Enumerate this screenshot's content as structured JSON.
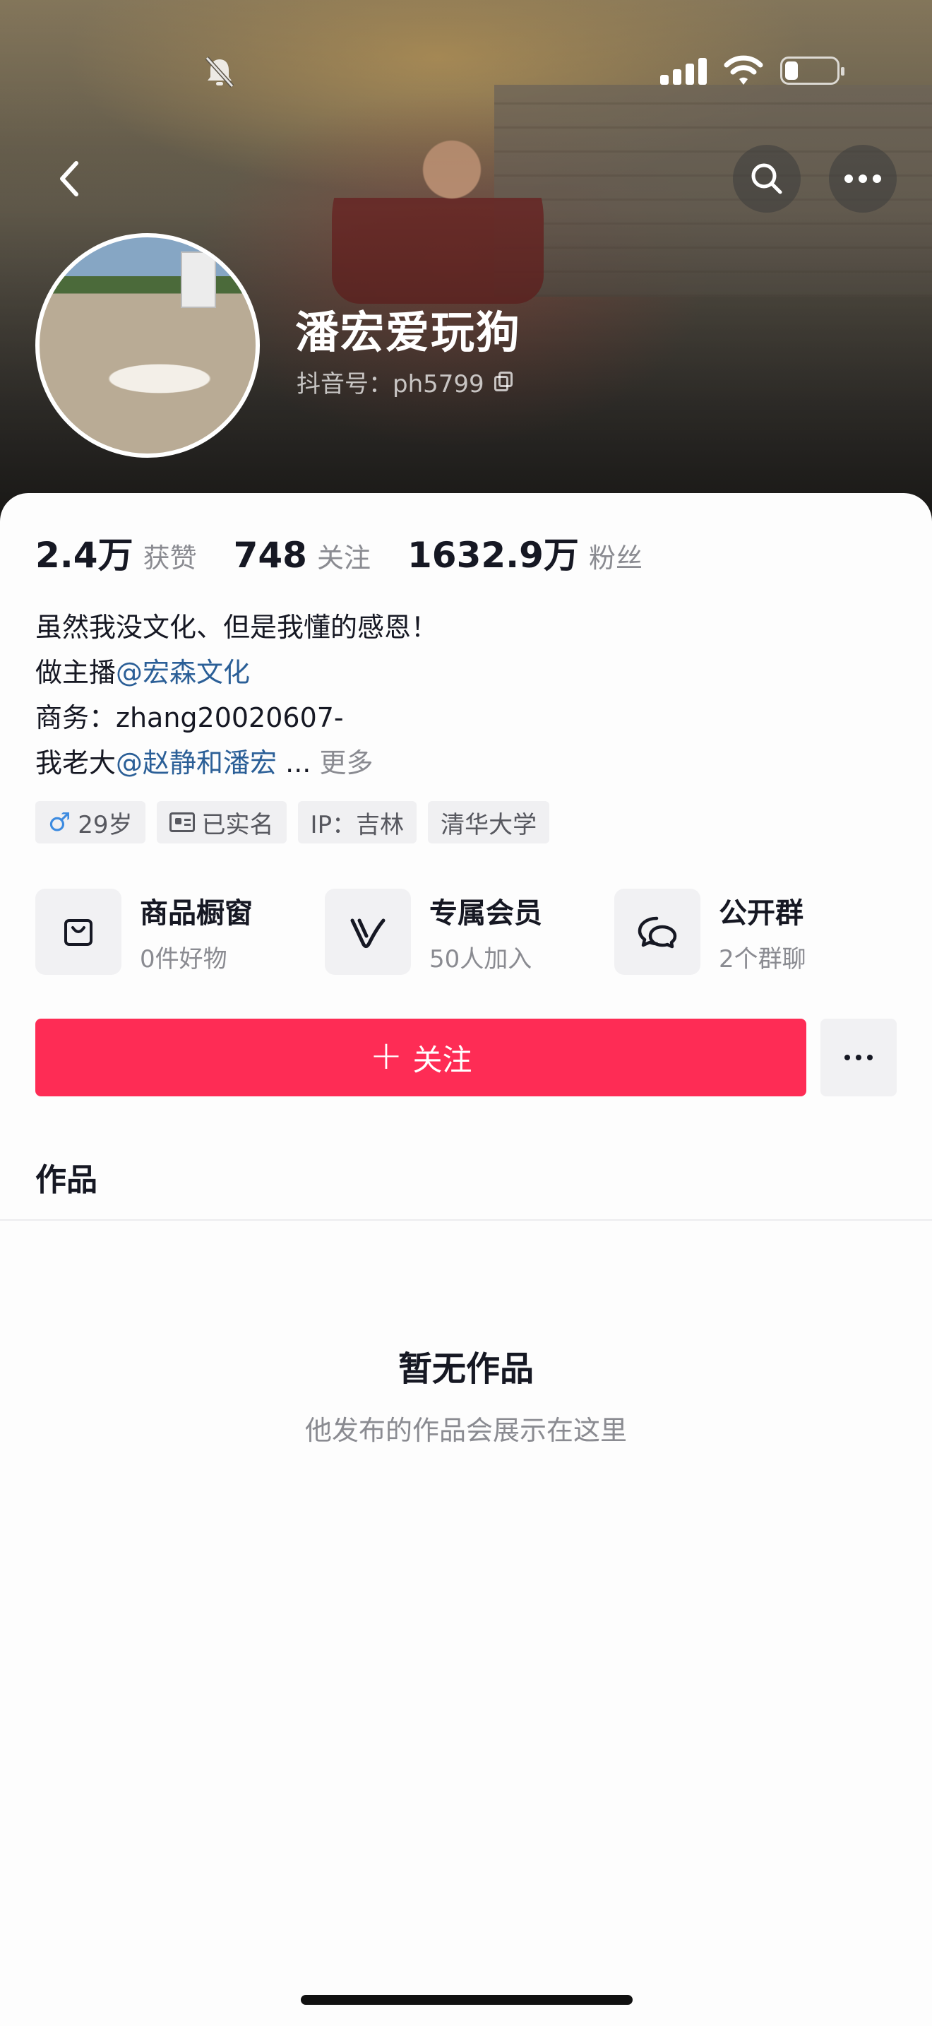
{
  "profile": {
    "nickname": "潘宏爱玩狗",
    "douyin_id": "抖音号：ph5799",
    "stats": [
      {
        "value": "2.4万",
        "label": "获赞"
      },
      {
        "value": "748",
        "label": "关注"
      },
      {
        "value": "1632.9万",
        "label": "粉丝"
      }
    ],
    "bio": {
      "line1": "虽然我没文化、但是我懂的感恩！",
      "line2_prefix": "做主播",
      "line2_mention": "@宏森文化",
      "line3": "商务：zhang20020607-",
      "line4_prefix": "我老大",
      "line4_mention": "@赵静和潘宏",
      "line4_ellipsis": " ... ",
      "more": "更多"
    },
    "tags": {
      "gender_symbol": "♂",
      "age": "29岁",
      "verified": "已实名",
      "ip": "IP：吉林",
      "school": "清华大学"
    }
  },
  "features": [
    {
      "title": "商品橱窗",
      "subtitle": "0件好物",
      "icon": "shopping-bag-icon"
    },
    {
      "title": "专属会员",
      "subtitle": "50人加入",
      "icon": "member-v-icon"
    },
    {
      "title": "公开群",
      "subtitle": "2个群聊",
      "icon": "group-chat-icon"
    }
  ],
  "actions": {
    "follow_label": "关注",
    "follow_plus": "+"
  },
  "works": {
    "tab_label": "作品",
    "empty_title": "暂无作品",
    "empty_subtitle": "他发布的作品会展示在这里"
  },
  "colors": {
    "follow_button": "#fe2c55",
    "mention": "#2b5f97"
  }
}
